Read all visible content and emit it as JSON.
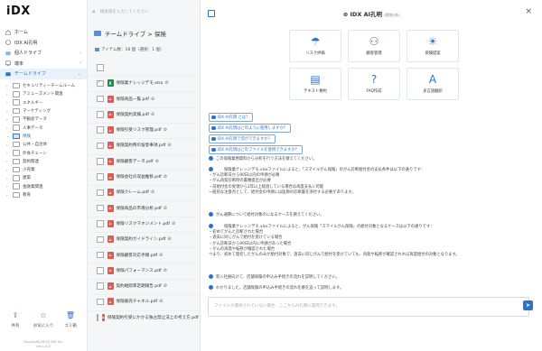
{
  "app": {
    "logo": "iDX"
  },
  "sidebar": {
    "nav": [
      {
        "label": "ホーム",
        "icon": "home-icon"
      },
      {
        "label": "IDX AI孔明",
        "icon": "ai-icon"
      },
      {
        "label": "個人ドライブ",
        "icon": "folder-icon"
      },
      {
        "label": "端末",
        "icon": "device-icon"
      },
      {
        "label": "チームドライブ",
        "icon": "folder-icon"
      }
    ],
    "team_folders": [
      "セキュリティーチームルーム",
      "アミューズメント関連",
      "エネルギー",
      "マーケティング",
      "不動産データ",
      "人事データ",
      "保険",
      "公共・自治体",
      "外食チェーン",
      "契約関連",
      "小売業",
      "建築",
      "金融業関連",
      "教育"
    ],
    "active_folder": "保険",
    "footer": [
      {
        "label": "共有",
        "icon": "share-icon"
      },
      {
        "label": "お気に入り",
        "icon": "star-icon"
      },
      {
        "label": "ゴミ箱",
        "icon": "trash-icon"
      }
    ],
    "copyright": [
      "Copyright(2023) IDX Inc.",
      "ver.1.0.0"
    ]
  },
  "search": {
    "placeholder": "検索語を入力してください"
  },
  "files": {
    "breadcrumb": "チームドライブ > 保険",
    "count_label": "アイテム数：18 個（選択：1 個）",
    "items": [
      {
        "name": "保険業ナレッジデモ.xlsx",
        "type": "xlsx",
        "checked": true
      },
      {
        "name": "保険商品一覧.pdf",
        "type": "pdf",
        "checked": false
      },
      {
        "name": "保険契約実績.pdf",
        "type": "pdf",
        "checked": false
      },
      {
        "name": "保険引受リスク管理.pdf",
        "type": "pdf",
        "checked": false
      },
      {
        "name": "保険契約時の留意事項.pdf",
        "type": "pdf",
        "checked": false
      },
      {
        "name": "保険顧客データ.pdf",
        "type": "pdf",
        "checked": false
      },
      {
        "name": "保険会社の収益推移.pdf",
        "type": "pdf",
        "checked": false
      },
      {
        "name": "保険クレーム.pdf",
        "type": "pdf",
        "checked": false
      },
      {
        "name": "保険商品の市場分析.pdf",
        "type": "pdf",
        "checked": false
      },
      {
        "name": "保険リスクマネジメント.pdf",
        "type": "pdf",
        "checked": false
      },
      {
        "name": "保険契約ガイドライン.pdf",
        "type": "pdf",
        "checked": false
      },
      {
        "name": "保険顧客対応手順.pdf",
        "type": "pdf",
        "checked": false
      },
      {
        "name": "保険パフォーマンス.pdf",
        "type": "pdf",
        "checked": false
      },
      {
        "name": "契約継続率定期報告.pdf",
        "type": "pdf",
        "checked": false
      },
      {
        "name": "保険販売チャネル.pdf",
        "type": "pdf",
        "checked": false
      },
      {
        "name": "保険契約引受にかかる独占禁止法上の考え方.pdf",
        "type": "pdf",
        "checked": false
      }
    ]
  },
  "chat": {
    "title": "IDX AI孔明",
    "title_sub": "(保険分析)",
    "cards": [
      {
        "label": "リスク評価",
        "icon": "umbrella-icon"
      },
      {
        "label": "顧客管理",
        "icon": "users-icon"
      },
      {
        "label": "保険提案",
        "icon": "lightbulb-icon"
      },
      {
        "label": "テキスト要約",
        "icon": "document-icon"
      },
      {
        "label": "FAQ作成",
        "icon": "faq-icon"
      },
      {
        "label": "多言語翻訳",
        "icon": "translate-icon"
      }
    ],
    "suggestions": [
      "IDX AI孔明 とは？",
      "IDX AI孔明はどのように使用しますか？",
      "IDX AI孔明で何ができますか？",
      "IDX AI孔明はどのファイルを使用できますか？"
    ],
    "messages": [
      "この保険業務資料から分析を行う方法を教えてください。",
      "保険業ナレッジデモ.xlsxファイルによると、「スマイルがん保険」のがん診断給付金の支払条件は以下の通りです：\n・がん診断日から90日以内の申請が必要\n・がん再発診断時の書類提出が必要\n・前給付金の受領から2年以上経過している場合は再度支払い可能\n一般的な注意点として、給付金の申請には医師の診断書を添付する必要があります。",
      "がん通算について給付対象のになるケースを教えてください。",
      "保険業ナレッジデモ.xlsxファイルによると、がん保険「スマイルがん保険」の給付対象となるケースは以下の通りです：\n・初めてがんと診断された場合\n・過去に同じがんで給付を受けている場合\n・がん診断日から90日以内に申請があった場合\n・がんの再発や転移が確認された場合\nつまり、初めて発症したがんのみが給付対象で、過去に同じがんで給付を受けていても、再発や転移が確認されれば再度給付の対象となります。",
      "新入社員向けて、店舗保険の申込み手続きの流れを説明してください。",
      "わかりました。店舗保険の申込み手続きの流れを順を追って説明します。"
    ],
    "input_placeholder": "ファイルが選択されていない場合、ここからAI孔明に質問できます。",
    "send_label": "➤"
  }
}
